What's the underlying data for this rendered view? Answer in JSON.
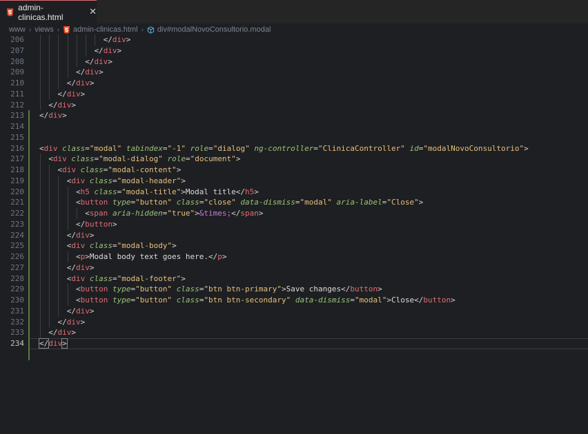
{
  "tab": {
    "title": "admin-clinicas.html",
    "icon": "html5-icon",
    "close_glyph": "✕"
  },
  "breadcrumb": [
    "www",
    "views",
    "admin-clinicas.html",
    "div#modalNovoConsultorio.modal"
  ],
  "colors": {
    "background": "#1e1f22",
    "tag": "#e06c75",
    "attr": "#98c379",
    "string": "#e5c07b",
    "entity": "#c678dd",
    "html_icon": "#e44d26"
  },
  "lines": [
    {
      "n": "206",
      "indent": 7,
      "tokens": [
        [
          "p",
          "</"
        ],
        [
          "t",
          "div"
        ],
        [
          "p",
          ">"
        ]
      ]
    },
    {
      "n": "207",
      "indent": 6,
      "tokens": [
        [
          "p",
          "</"
        ],
        [
          "t",
          "div"
        ],
        [
          "p",
          ">"
        ]
      ]
    },
    {
      "n": "208",
      "indent": 5,
      "tokens": [
        [
          "p",
          "</"
        ],
        [
          "t",
          "div"
        ],
        [
          "p",
          ">"
        ]
      ]
    },
    {
      "n": "209",
      "indent": 4,
      "tokens": [
        [
          "p",
          "</"
        ],
        [
          "t",
          "div"
        ],
        [
          "p",
          ">"
        ]
      ]
    },
    {
      "n": "210",
      "indent": 3,
      "tokens": [
        [
          "p",
          "</"
        ],
        [
          "t",
          "div"
        ],
        [
          "p",
          ">"
        ]
      ]
    },
    {
      "n": "211",
      "indent": 2,
      "tokens": [
        [
          "p",
          "</"
        ],
        [
          "t",
          "div"
        ],
        [
          "p",
          ">"
        ]
      ]
    },
    {
      "n": "212",
      "indent": 1,
      "tokens": [
        [
          "p",
          "</"
        ],
        [
          "t",
          "div"
        ],
        [
          "p",
          ">"
        ]
      ]
    },
    {
      "n": "213",
      "indent": 0,
      "tokens": [
        [
          "p",
          "</"
        ],
        [
          "t",
          "div"
        ],
        [
          "p",
          ">"
        ]
      ]
    },
    {
      "n": "214",
      "indent": 0,
      "tokens": []
    },
    {
      "n": "215",
      "indent": 0,
      "tokens": []
    },
    {
      "n": "216",
      "indent": 0,
      "tokens": [
        [
          "p",
          "<"
        ],
        [
          "t",
          "div"
        ],
        [
          "p",
          " "
        ],
        [
          "a",
          "class"
        ],
        [
          "p",
          "="
        ],
        [
          "s",
          "\"modal\""
        ],
        [
          "p",
          " "
        ],
        [
          "a",
          "tabindex"
        ],
        [
          "p",
          "="
        ],
        [
          "s",
          "\"-1\""
        ],
        [
          "p",
          " "
        ],
        [
          "a",
          "role"
        ],
        [
          "p",
          "="
        ],
        [
          "s",
          "\"dialog\""
        ],
        [
          "p",
          " "
        ],
        [
          "a",
          "ng-controller"
        ],
        [
          "p",
          "="
        ],
        [
          "s",
          "\"ClinicaController\""
        ],
        [
          "p",
          " "
        ],
        [
          "a",
          "id"
        ],
        [
          "p",
          "="
        ],
        [
          "s",
          "\"modalNovoConsultorio\""
        ],
        [
          "p",
          ">"
        ]
      ]
    },
    {
      "n": "217",
      "indent": 1,
      "tokens": [
        [
          "p",
          "<"
        ],
        [
          "t",
          "div"
        ],
        [
          "p",
          " "
        ],
        [
          "a",
          "class"
        ],
        [
          "p",
          "="
        ],
        [
          "s",
          "\"modal-dialog\""
        ],
        [
          "p",
          " "
        ],
        [
          "a",
          "role"
        ],
        [
          "p",
          "="
        ],
        [
          "s",
          "\"document\""
        ],
        [
          "p",
          ">"
        ]
      ]
    },
    {
      "n": "218",
      "indent": 2,
      "tokens": [
        [
          "p",
          "<"
        ],
        [
          "t",
          "div"
        ],
        [
          "p",
          " "
        ],
        [
          "a",
          "class"
        ],
        [
          "p",
          "="
        ],
        [
          "s",
          "\"modal-content\""
        ],
        [
          "p",
          ">"
        ]
      ]
    },
    {
      "n": "219",
      "indent": 3,
      "tokens": [
        [
          "p",
          "<"
        ],
        [
          "t",
          "div"
        ],
        [
          "p",
          " "
        ],
        [
          "a",
          "class"
        ],
        [
          "p",
          "="
        ],
        [
          "s",
          "\"modal-header\""
        ],
        [
          "p",
          ">"
        ]
      ]
    },
    {
      "n": "220",
      "indent": 4,
      "tokens": [
        [
          "p",
          "<"
        ],
        [
          "t",
          "h5"
        ],
        [
          "p",
          " "
        ],
        [
          "a",
          "class"
        ],
        [
          "p",
          "="
        ],
        [
          "s",
          "\"modal-title\""
        ],
        [
          "p",
          ">"
        ],
        [
          "x",
          "Modal title"
        ],
        [
          "p",
          "</"
        ],
        [
          "t",
          "h5"
        ],
        [
          "p",
          ">"
        ]
      ]
    },
    {
      "n": "221",
      "indent": 4,
      "tokens": [
        [
          "p",
          "<"
        ],
        [
          "t",
          "button"
        ],
        [
          "p",
          " "
        ],
        [
          "a",
          "type"
        ],
        [
          "p",
          "="
        ],
        [
          "s",
          "\"button\""
        ],
        [
          "p",
          " "
        ],
        [
          "a",
          "class"
        ],
        [
          "p",
          "="
        ],
        [
          "s",
          "\"close\""
        ],
        [
          "p",
          " "
        ],
        [
          "a",
          "data-dismiss"
        ],
        [
          "p",
          "="
        ],
        [
          "s",
          "\"modal\""
        ],
        [
          "p",
          " "
        ],
        [
          "a",
          "aria-label"
        ],
        [
          "p",
          "="
        ],
        [
          "s",
          "\"Close\""
        ],
        [
          "p",
          ">"
        ]
      ]
    },
    {
      "n": "222",
      "indent": 5,
      "tokens": [
        [
          "p",
          "<"
        ],
        [
          "t",
          "span"
        ],
        [
          "p",
          " "
        ],
        [
          "a",
          "aria-hidden"
        ],
        [
          "p",
          "="
        ],
        [
          "s",
          "\"true\""
        ],
        [
          "p",
          ">"
        ],
        [
          "e",
          "&times;"
        ],
        [
          "p",
          "</"
        ],
        [
          "t",
          "span"
        ],
        [
          "p",
          ">"
        ]
      ]
    },
    {
      "n": "223",
      "indent": 4,
      "tokens": [
        [
          "p",
          "</"
        ],
        [
          "t",
          "button"
        ],
        [
          "p",
          ">"
        ]
      ]
    },
    {
      "n": "224",
      "indent": 3,
      "tokens": [
        [
          "p",
          "</"
        ],
        [
          "t",
          "div"
        ],
        [
          "p",
          ">"
        ]
      ]
    },
    {
      "n": "225",
      "indent": 3,
      "tokens": [
        [
          "p",
          "<"
        ],
        [
          "t",
          "div"
        ],
        [
          "p",
          " "
        ],
        [
          "a",
          "class"
        ],
        [
          "p",
          "="
        ],
        [
          "s",
          "\"modal-body\""
        ],
        [
          "p",
          ">"
        ]
      ]
    },
    {
      "n": "226",
      "indent": 4,
      "tokens": [
        [
          "p",
          "<"
        ],
        [
          "t",
          "p"
        ],
        [
          "p",
          ">"
        ],
        [
          "x",
          "Modal body text goes here."
        ],
        [
          "p",
          "</"
        ],
        [
          "t",
          "p"
        ],
        [
          "p",
          ">"
        ]
      ]
    },
    {
      "n": "227",
      "indent": 3,
      "tokens": [
        [
          "p",
          "</"
        ],
        [
          "t",
          "div"
        ],
        [
          "p",
          ">"
        ]
      ]
    },
    {
      "n": "228",
      "indent": 3,
      "tokens": [
        [
          "p",
          "<"
        ],
        [
          "t",
          "div"
        ],
        [
          "p",
          " "
        ],
        [
          "a",
          "class"
        ],
        [
          "p",
          "="
        ],
        [
          "s",
          "\"modal-footer\""
        ],
        [
          "p",
          ">"
        ]
      ]
    },
    {
      "n": "229",
      "indent": 4,
      "tokens": [
        [
          "p",
          "<"
        ],
        [
          "t",
          "button"
        ],
        [
          "p",
          " "
        ],
        [
          "a",
          "type"
        ],
        [
          "p",
          "="
        ],
        [
          "s",
          "\"button\""
        ],
        [
          "p",
          " "
        ],
        [
          "a",
          "class"
        ],
        [
          "p",
          "="
        ],
        [
          "s",
          "\"btn btn-primary\""
        ],
        [
          "p",
          ">"
        ],
        [
          "x",
          "Save changes"
        ],
        [
          "p",
          "</"
        ],
        [
          "t",
          "button"
        ],
        [
          "p",
          ">"
        ]
      ]
    },
    {
      "n": "230",
      "indent": 4,
      "tokens": [
        [
          "p",
          "<"
        ],
        [
          "t",
          "button"
        ],
        [
          "p",
          " "
        ],
        [
          "a",
          "type"
        ],
        [
          "p",
          "="
        ],
        [
          "s",
          "\"button\""
        ],
        [
          "p",
          " "
        ],
        [
          "a",
          "class"
        ],
        [
          "p",
          "="
        ],
        [
          "s",
          "\"btn btn-secondary\""
        ],
        [
          "p",
          " "
        ],
        [
          "a",
          "data-dismiss"
        ],
        [
          "p",
          "="
        ],
        [
          "s",
          "\"modal\""
        ],
        [
          "p",
          ">"
        ],
        [
          "x",
          "Close"
        ],
        [
          "p",
          "</"
        ],
        [
          "t",
          "button"
        ],
        [
          "p",
          ">"
        ]
      ]
    },
    {
      "n": "231",
      "indent": 3,
      "tokens": [
        [
          "p",
          "</"
        ],
        [
          "t",
          "div"
        ],
        [
          "p",
          ">"
        ]
      ]
    },
    {
      "n": "232",
      "indent": 2,
      "tokens": [
        [
          "p",
          "</"
        ],
        [
          "t",
          "div"
        ],
        [
          "p",
          ">"
        ]
      ]
    },
    {
      "n": "233",
      "indent": 1,
      "tokens": [
        [
          "p",
          "</"
        ],
        [
          "t",
          "div"
        ],
        [
          "p",
          ">"
        ]
      ]
    },
    {
      "n": "234",
      "indent": 0,
      "active": true,
      "tokens": [
        [
          "p",
          "</"
        ],
        [
          "t",
          "div"
        ],
        [
          "p",
          ">"
        ]
      ]
    }
  ]
}
